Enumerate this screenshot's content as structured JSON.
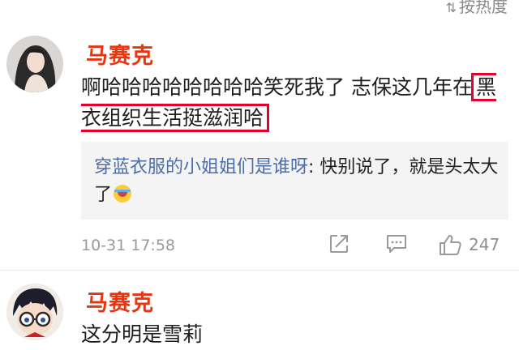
{
  "sort": {
    "icon": "sort-arrows-icon",
    "label": "按热度"
  },
  "comments": [
    {
      "avatar": "avatar-woman-photo",
      "username": "马赛克",
      "text_plain": "啊哈哈哈哈哈哈哈哈笑死我了 志保这几年在",
      "text_highlight": "黑衣组织生活挺滋润哈",
      "reply": {
        "user": "穿蓝衣服的小姐姐们是谁呀",
        "separator": ": ",
        "text": "快别说了，就是头太大了",
        "emoji": "laugh-cry-emoji"
      },
      "timestamp": "10-31 17:58",
      "actions": {
        "share_icon": "share-icon",
        "comment_icon": "comment-icon",
        "like_icon": "thumbs-up-icon",
        "like_count": "247"
      }
    },
    {
      "avatar": "avatar-anime-glasses",
      "username": "马赛克",
      "text_plain": "这分明是雪莉"
    }
  ],
  "colors": {
    "username": "#e8340f",
    "highlight_border": "#e4002b",
    "reply_user": "#4a6ea9",
    "meta": "#9a9a9a"
  }
}
